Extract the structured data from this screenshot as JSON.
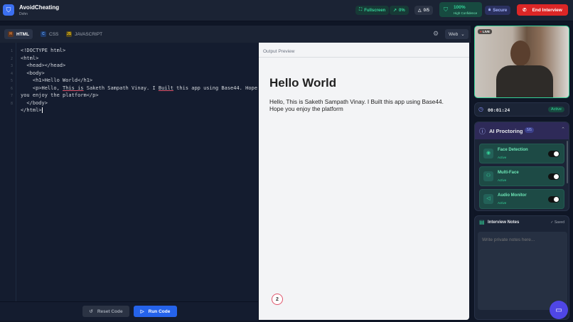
{
  "header": {
    "app_name": "AvoidCheating",
    "subtitle": "Dohn",
    "fullscreen": "Fullscreen",
    "trend": "0%",
    "warnings": "0/5",
    "confidence": "100%",
    "confidence_label": "High Confidence",
    "secure": "Secure",
    "end_interview": "End Interview"
  },
  "toolbar": {
    "tabs": [
      {
        "badge": "H",
        "label": "HTML"
      },
      {
        "badge": "C",
        "label": "CSS"
      },
      {
        "badge": "JS",
        "label": "JAVASCRIPT"
      }
    ],
    "mode": "Web"
  },
  "editor": {
    "line_numbers": [
      "1",
      "2",
      "3",
      "4",
      "5",
      "6",
      "7",
      "8"
    ],
    "lines": [
      "<!DOCTYPE html>",
      "<html>",
      "  <head></head>",
      "  <body>",
      "    <h1>Hello World</h1>"
    ],
    "line6_a": "    <p>Hello, ",
    "line6_u1": "This is",
    "line6_b": " Saketh Sampath Vinay. I ",
    "line6_u2": "Built",
    "line6_c": " this app using Base44. Hope",
    "line7": "you enjoy the platform</p>",
    "line8": "  </body>",
    "line9": "</html>"
  },
  "actions": {
    "reset": "Reset Code",
    "run": "Run Code"
  },
  "preview": {
    "label": "Output Preview",
    "heading": "Hello World",
    "paragraph": "Hello, This is Saketh Sampath Vinay. I Built this app using Base44. Hope you enjoy the platform",
    "badge": "2"
  },
  "video": {
    "live": "LIVE"
  },
  "timer": {
    "time": "00:01:24",
    "status": "Active"
  },
  "proctoring": {
    "title": "AI Proctoring",
    "count": "5/5",
    "features": [
      {
        "name": "Face Detection",
        "status": "Active"
      },
      {
        "name": "Multi-Face",
        "status": "Active"
      },
      {
        "name": "Audio Monitor",
        "status": "Active"
      }
    ]
  },
  "notes": {
    "title": "Interview Notes",
    "saved": "✓ Saved",
    "placeholder": "Write private notes here..."
  }
}
